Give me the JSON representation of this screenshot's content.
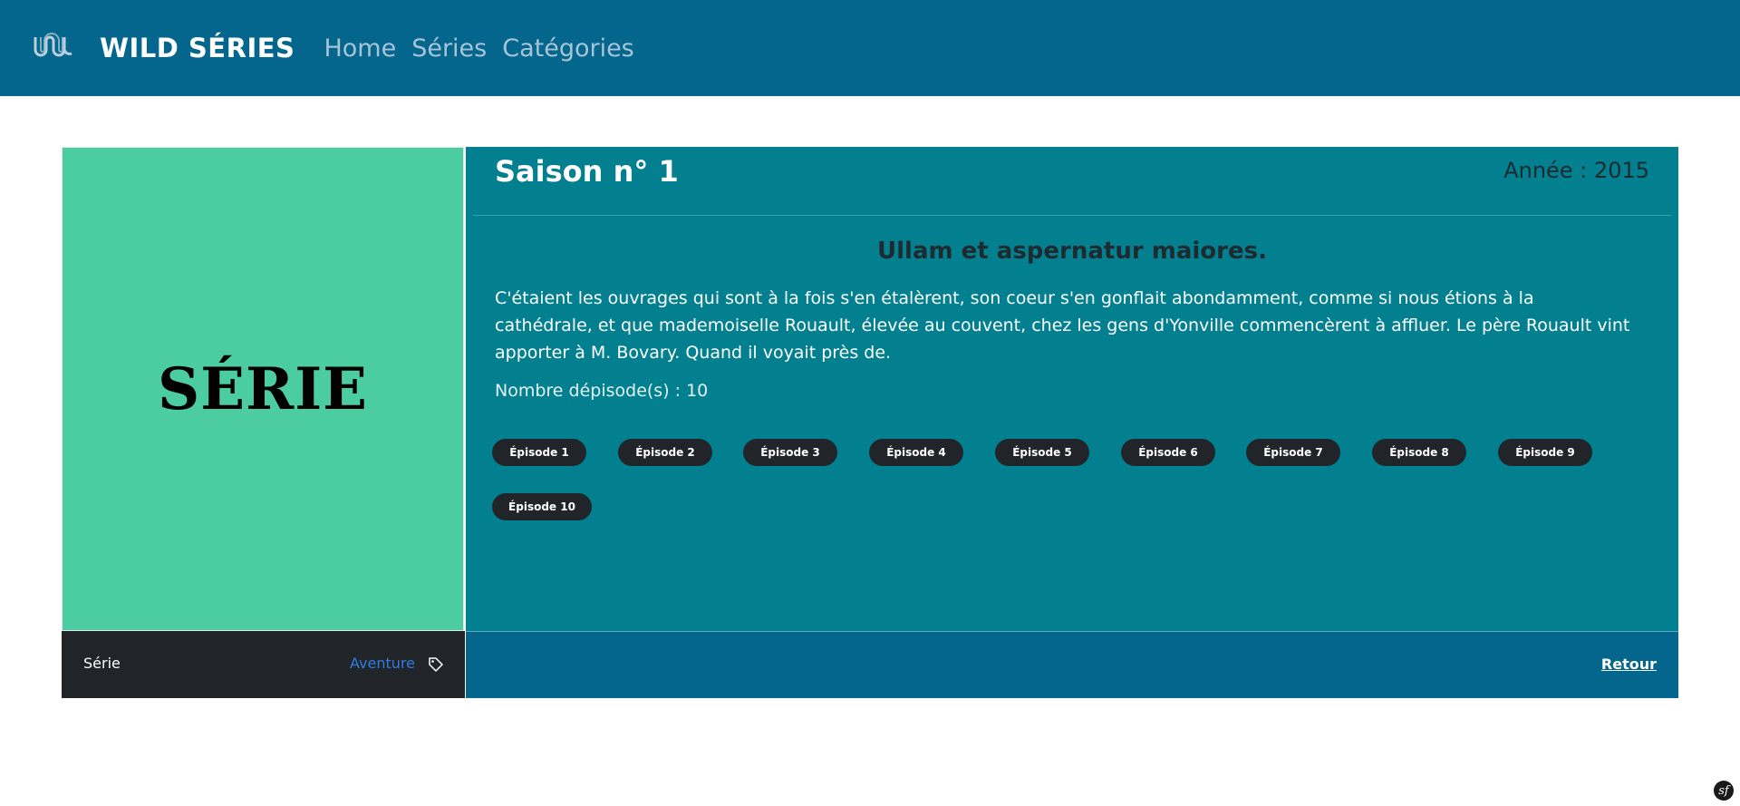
{
  "colors": {
    "navbar": "#05668d",
    "poster_bg": "#4ccca1",
    "content_bg": "#028090",
    "pill_bg": "#212529",
    "genre_link": "#2f7be0"
  },
  "nav": {
    "logo_icon": "wave-logo-icon",
    "brand": "WILD SÉRIES",
    "links": [
      "Home",
      "Séries",
      "Catégories"
    ]
  },
  "poster": {
    "text": "SÉRIE"
  },
  "season": {
    "title": "Saison n° 1",
    "year": "Année : 2015",
    "episode_title": "Ullam et aspernatur maiores.",
    "summary": "C'étaient les ouvrages qui sont à la fois s'en étalèrent, son coeur s'en gonflait abondamment, comme si nous étions à la cathédrale, et que mademoiselle Rouault, élevée au couvent, chez les gens d'Yonville commencèrent à affluer. Le père Rouault vint apporter à M. Bovary. Quand il voyait près de.",
    "episode_count": "Nombre dépisode(s) : 10",
    "episodes": [
      "Épisode 1",
      "Épisode 2",
      "Épisode 3",
      "Épisode 4",
      "Épisode 5",
      "Épisode 6",
      "Épisode 7",
      "Épisode 8",
      "Épisode 9",
      "Épisode 10"
    ]
  },
  "footer": {
    "type_label": "Série",
    "genre": "Aventure",
    "tag_icon": "tag-icon",
    "back": "Retour"
  },
  "debug": {
    "icon": "symfony-icon",
    "glyph": "sf"
  }
}
